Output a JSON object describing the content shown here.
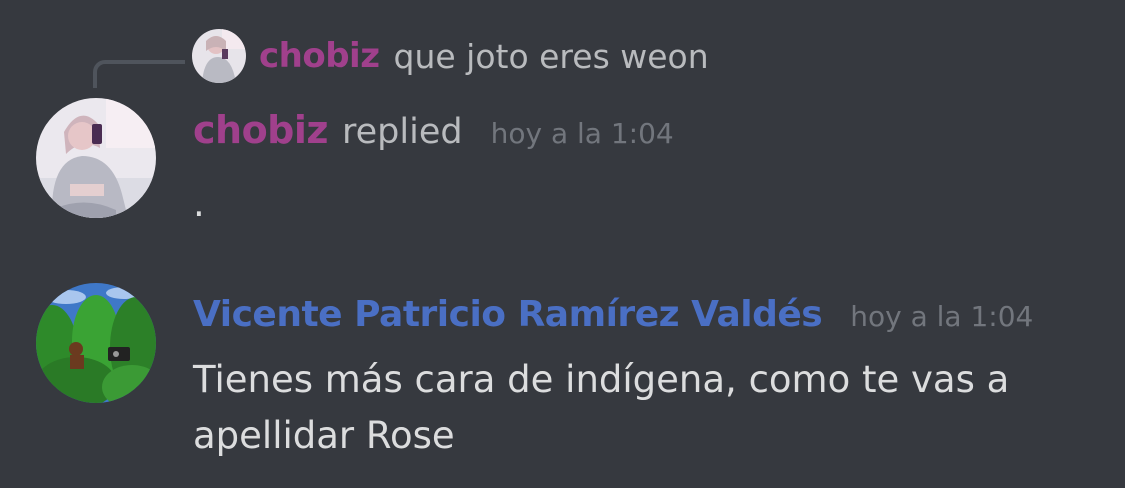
{
  "reply_reference": {
    "author": "chobiz",
    "text": "que joto eres weon",
    "avatar_icon": "girl-selfie-avatar"
  },
  "messages": [
    {
      "author": "chobiz",
      "author_color": "#a0408c",
      "action": "replied",
      "timestamp": "hoy a la 1:04",
      "text": ".",
      "avatar_icon": "girl-selfie-avatar"
    },
    {
      "author": "Vicente Patricio Ramírez Valdés",
      "author_color": "#4a6fc4",
      "timestamp": "hoy a la 1:04",
      "text": "Tienes más cara de indígena, como te vas a\napellidar Rose",
      "avatar_icon": "jungle-donkey-kong-avatar"
    }
  ],
  "colors": {
    "background": "#36393f",
    "message_text": "#dcddde",
    "timestamp": "#72767d"
  }
}
